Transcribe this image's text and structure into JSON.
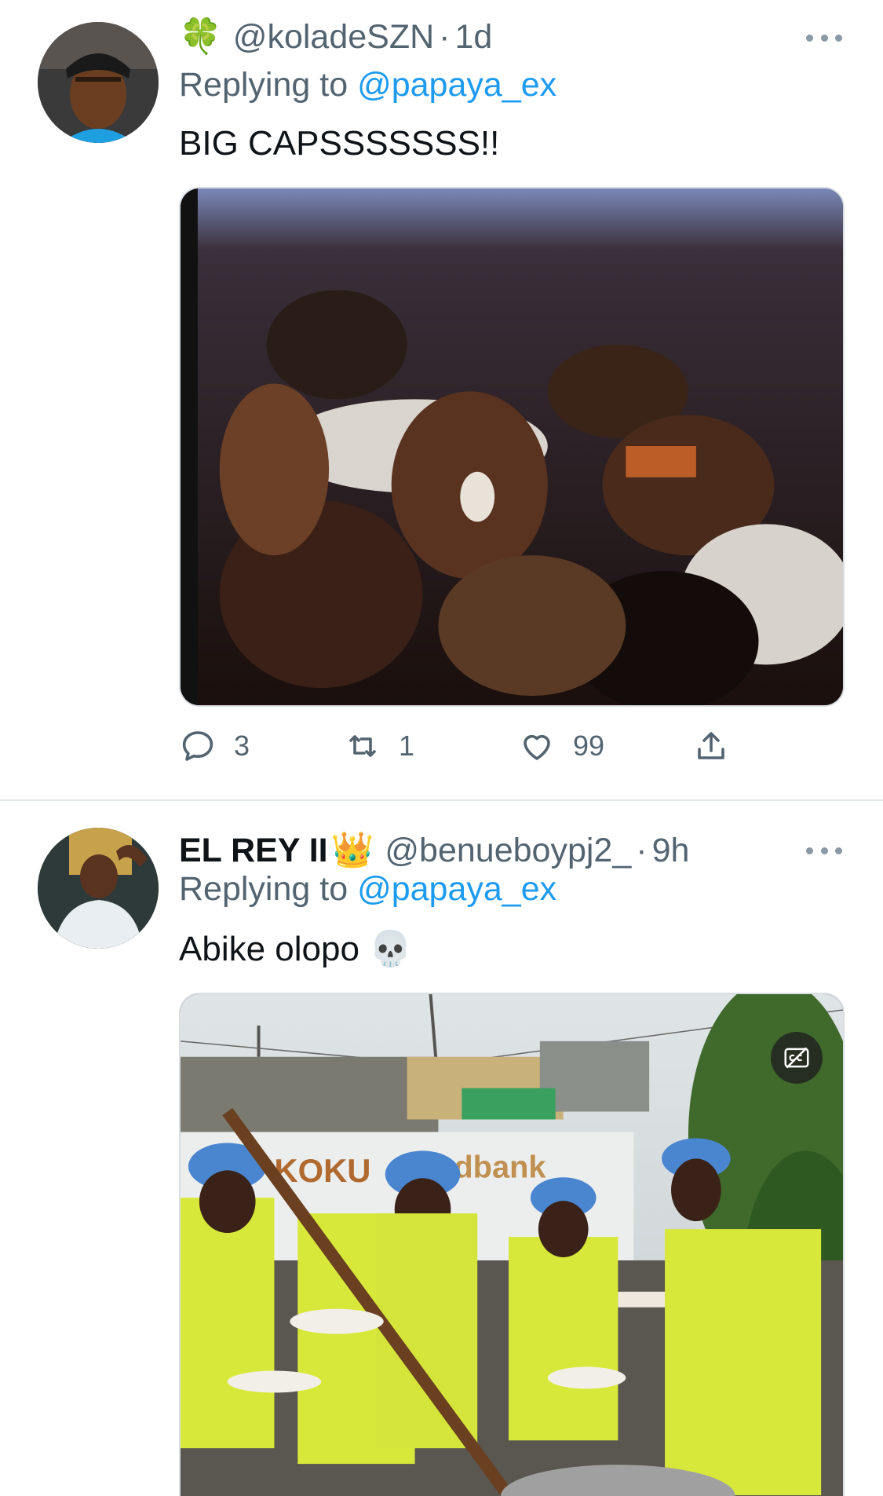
{
  "tweets": [
    {
      "emoji": "🍀",
      "name": "",
      "handle": "@koladeSZN",
      "time": "1d",
      "replying_prefix": "Replying to ",
      "replying_to": "@papaya_ex",
      "text": "BIG CAPSSSSSSS!!",
      "actions": {
        "replies": "3",
        "retweets": "1",
        "likes": "99"
      }
    },
    {
      "name": "EL REY II",
      "emoji": "👑",
      "handle": "@benueboypj2_",
      "time": "9h",
      "replying_prefix": "Replying to ",
      "replying_to": "@papaya_ex",
      "text": "Abike olopo 💀",
      "media_text": {
        "van_logo": "KOKU",
        "van_brand": "dbank"
      }
    }
  ],
  "icons": {
    "reply": "speech-bubble-icon",
    "retweet": "retweet-icon",
    "like": "heart-icon",
    "share": "share-upload-icon",
    "more": "more-horizontal-icon",
    "captions": "captions-off-icon"
  },
  "colors": {
    "link": "#1d9bf0",
    "secondary_text": "#536471",
    "primary_text": "#0f1419",
    "divider": "#e1e6ea"
  }
}
